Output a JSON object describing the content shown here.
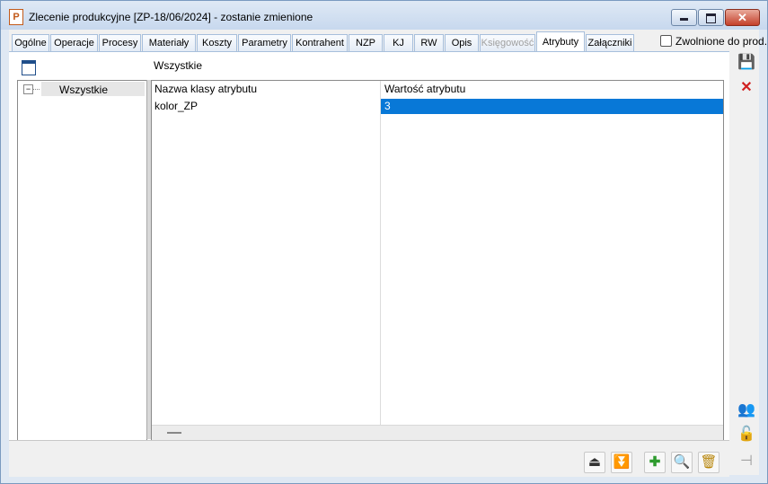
{
  "window": {
    "app_icon_letter": "P",
    "title": "Zlecenie produkcyjne  [ZP-18/06/2024] - zostanie zmienione",
    "close_glyph": "✕"
  },
  "tabs": [
    {
      "label": "Ogólne",
      "state": "normal"
    },
    {
      "label": "Operacje",
      "state": "normal"
    },
    {
      "label": "Procesy",
      "state": "normal"
    },
    {
      "label": "Materiały",
      "state": "normal"
    },
    {
      "label": "Koszty",
      "state": "normal"
    },
    {
      "label": "Parametry",
      "state": "normal"
    },
    {
      "label": "Kontrahent",
      "state": "normal"
    },
    {
      "label": "NZP",
      "state": "normal"
    },
    {
      "label": "KJ",
      "state": "normal"
    },
    {
      "label": "RW",
      "state": "normal"
    },
    {
      "label": "Opis",
      "state": "normal"
    },
    {
      "label": "Księgowość",
      "state": "disabled"
    },
    {
      "label": "Atrybuty",
      "state": "active"
    },
    {
      "label": "Załączniki",
      "state": "normal"
    }
  ],
  "released_checkbox": {
    "label": "Zwolnione do prod.",
    "checked": false
  },
  "panel": {
    "header_label": "Wszystkie"
  },
  "tree": {
    "toggle_glyph": "−",
    "root_label": "Wszystkie"
  },
  "grid": {
    "columns": [
      "Nazwa klasy atrybutu",
      "Wartość atrybutu"
    ],
    "rows": [
      {
        "name": "kolor_ZP",
        "value": "3"
      }
    ]
  },
  "bottom_buttons": [
    {
      "icon": "move-up-icon",
      "glyph": "⏏"
    },
    {
      "icon": "move-down-icon",
      "glyph": "⏬"
    },
    {
      "icon": "add-icon",
      "glyph": "✚"
    },
    {
      "icon": "search-icon",
      "glyph": "🔍"
    },
    {
      "icon": "delete-icon",
      "glyph": "🗑"
    }
  ],
  "side_buttons": [
    {
      "icon": "save-icon",
      "glyph": "💾"
    },
    {
      "icon": "cancel-icon",
      "glyph": "✕"
    },
    {
      "icon": "users-icon",
      "glyph": "👥"
    },
    {
      "icon": "lock-icon",
      "glyph": "🔓"
    },
    {
      "icon": "pin-icon",
      "glyph": "⊣"
    }
  ],
  "colors": {
    "accent": "#0878d7",
    "window_bg": "#dfe8f3",
    "close_button": "#c4402a"
  }
}
